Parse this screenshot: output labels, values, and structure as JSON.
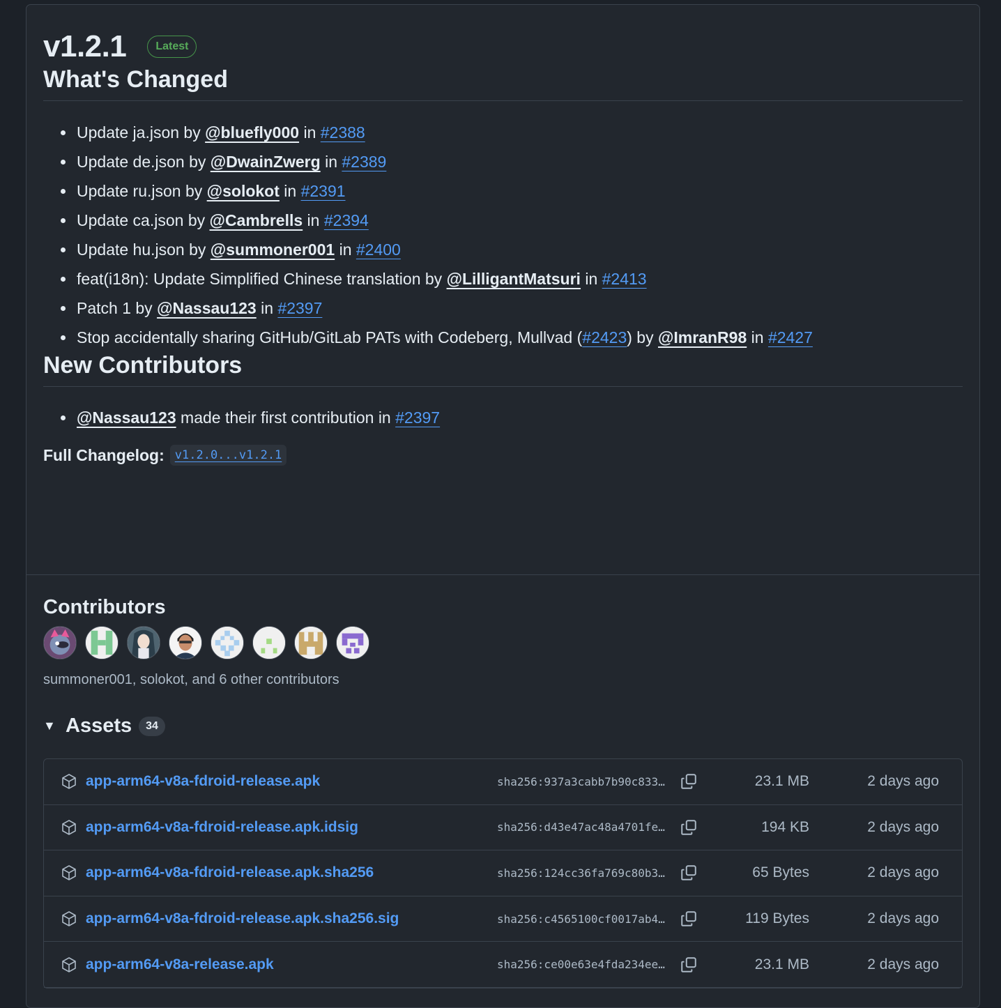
{
  "release": {
    "title": "v1.2.1",
    "badge": "Latest"
  },
  "whats_changed": {
    "heading": "What's Changed",
    "items": [
      {
        "prefix": "Update ja.json by ",
        "user": "@bluefly000",
        "mid": " in ",
        "pr": "#2388"
      },
      {
        "prefix": "Update de.json by ",
        "user": "@DwainZwerg",
        "mid": " in ",
        "pr": "#2389"
      },
      {
        "prefix": "Update ru.json by ",
        "user": "@solokot",
        "mid": " in ",
        "pr": "#2391"
      },
      {
        "prefix": "Update ca.json by ",
        "user": "@Cambrells",
        "mid": " in ",
        "pr": "#2394"
      },
      {
        "prefix": "Update hu.json by ",
        "user": "@summoner001",
        "mid": " in ",
        "pr": "#2400"
      },
      {
        "prefix": "feat(i18n): Update Simplified Chinese translation by ",
        "user": "@LilligantMatsuri",
        "mid": " in ",
        "pr": "#2413"
      },
      {
        "prefix": "Patch 1 by ",
        "user": "@Nassau123",
        "mid": " in ",
        "pr": "#2397"
      }
    ],
    "last_item": {
      "prefix": "Stop accidentally sharing GitHub/GitLab PATs with Codeberg, Mullvad (",
      "pr_a": "#2423",
      "after_pr_a": ") by ",
      "user": "@ImranR98",
      "mid": " in ",
      "pr_b": "#2427"
    }
  },
  "new_contributors": {
    "heading": "New Contributors",
    "user": "@Nassau123",
    "text": " made their first contribution in ",
    "pr": "#2397"
  },
  "full_changelog": {
    "label": "Full Changelog:",
    "link": "v1.2.0...v1.2.1"
  },
  "contributors": {
    "heading": "Contributors",
    "summary": "summoner001, solokot, and 6 other contributors",
    "avatars": [
      "avatar-cat",
      "avatar-green-identicon",
      "avatar-anime",
      "avatar-person",
      "avatar-blue-identicon",
      "avatar-lightgreen-identicon",
      "avatar-tan-identicon",
      "avatar-purple-identicon"
    ]
  },
  "assets": {
    "heading": "Assets",
    "count": "34",
    "rows": [
      {
        "name": "app-arm64-v8a-fdroid-release.apk",
        "sha": "sha256:937a3cabb7b90c833…",
        "size": "23.1 MB",
        "date": "2 days ago"
      },
      {
        "name": "app-arm64-v8a-fdroid-release.apk.idsig",
        "sha": "sha256:d43e47ac48a4701fe…",
        "size": "194 KB",
        "date": "2 days ago"
      },
      {
        "name": "app-arm64-v8a-fdroid-release.apk.sha256",
        "sha": "sha256:124cc36fa769c80b3…",
        "size": "65 Bytes",
        "date": "2 days ago"
      },
      {
        "name": "app-arm64-v8a-fdroid-release.apk.sha256.sig",
        "sha": "sha256:c4565100cf0017ab4…",
        "size": "119 Bytes",
        "date": "2 days ago"
      },
      {
        "name": "app-arm64-v8a-release.apk",
        "sha": "sha256:ce00e63e4fda234ee…",
        "size": "23.1 MB",
        "date": "2 days ago"
      }
    ]
  },
  "colors": {
    "background": "#22272e",
    "link": "#539bf5",
    "latest_badge": "#57ab5a"
  }
}
